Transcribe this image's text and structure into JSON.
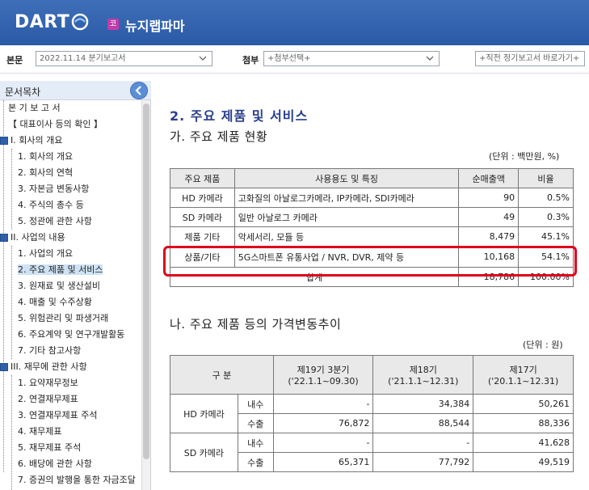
{
  "header": {
    "logo": "DART",
    "corp_badge": "코",
    "corp_name": "뉴지랩파마"
  },
  "toolbar": {
    "report_label": "본문",
    "report_value": "2022.11.14  분기보고서",
    "attach_label": "첨부",
    "attach_value": "+첨부선택+",
    "recent_value": "+직전 정기보고서 바로가기+"
  },
  "sidebar": {
    "title": "문서목차",
    "items": [
      {
        "label": "본 기 보 고 서"
      },
      {
        "label": "【 대표이사 등의 확인 】"
      },
      {
        "label": "I. 회사의 개요"
      },
      {
        "label": "1. 회사의 개요"
      },
      {
        "label": "2. 회사의 연혁"
      },
      {
        "label": "3. 자본금 변동사항"
      },
      {
        "label": "4. 주식의 총수 등"
      },
      {
        "label": "5. 정관에 관한 사항"
      },
      {
        "label": "II. 사업의 내용"
      },
      {
        "label": "1. 사업의 개요"
      },
      {
        "label": "2. 주요 제품 및 서비스"
      },
      {
        "label": "3. 원재료 및 생산설비"
      },
      {
        "label": "4. 매출 및 수주상황"
      },
      {
        "label": "5. 위험관리 및 파생거래"
      },
      {
        "label": "6. 주요계약 및 연구개발활동"
      },
      {
        "label": "7. 기타 참고사항"
      },
      {
        "label": "III. 재무에 관한 사항"
      },
      {
        "label": "1. 요약재무정보"
      },
      {
        "label": "2. 연결재무제표"
      },
      {
        "label": "3. 연결재무제표 주석"
      },
      {
        "label": "4. 재무제표"
      },
      {
        "label": "5. 재무제표 주석"
      },
      {
        "label": "6. 배당에 관한 사항"
      },
      {
        "label": "7. 증권의 발행을 통한 자금조달"
      }
    ]
  },
  "main": {
    "section_title": "2. 주요 제품 및 서비스",
    "sub_a": "가. 주요 제품 현황",
    "unit_a": "(단위 : 백만원, %)",
    "table_a": {
      "headers": [
        "주요 제품",
        "사용용도 및 특징",
        "순매출액",
        "비율"
      ],
      "rows": [
        [
          "HD 카메라",
          "고화질의 아날로그카메라, IP카메라, SDI카메라",
          "90",
          "0.5%"
        ],
        [
          "SD 카메라",
          "일반 아날로그 카메라",
          "49",
          "0.3%"
        ],
        [
          "제품 기타",
          "악세서리, 모듈 등",
          "8,479",
          "45.1%"
        ],
        [
          "상품/기타",
          "5G스마트폰 유통사업 / NVR, DVR, 제약 등",
          "10,168",
          "54.1%"
        ]
      ],
      "total_label": "합계",
      "total_sales": "18,786",
      "total_ratio": "100.00%"
    },
    "sub_b": "나. 주요 제품 등의 가격변동추이",
    "unit_b": "(단위 : 원)",
    "table_b": {
      "col_group": "구 분",
      "periods": [
        {
          "name": "제19기 3분기",
          "range": "('22.1.1~09.30)"
        },
        {
          "name": "제18기",
          "range": "('21.1.1~12.31)"
        },
        {
          "name": "제17기",
          "range": "('20.1.1~12.31)"
        }
      ],
      "groups": [
        {
          "name": "HD 카메라",
          "rows": [
            {
              "type": "내수",
              "v": [
                "-",
                "34,384",
                "50,261"
              ]
            },
            {
              "type": "수출",
              "v": [
                "76,872",
                "88,544",
                "88,336"
              ]
            }
          ]
        },
        {
          "name": "SD 카메라",
          "rows": [
            {
              "type": "내수",
              "v": [
                "-",
                "-",
                "41,628"
              ]
            },
            {
              "type": "수출",
              "v": [
                "65,371",
                "77,792",
                "49,519"
              ]
            }
          ]
        }
      ]
    }
  }
}
